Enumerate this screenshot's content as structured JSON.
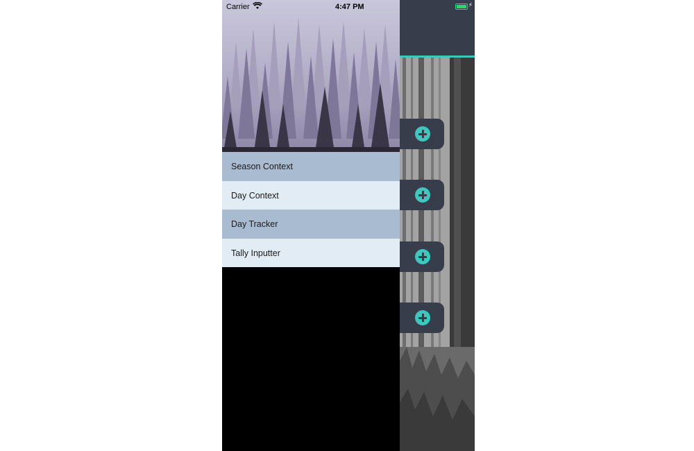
{
  "status_bar": {
    "carrier": "Carrier",
    "time": "4:47 PM",
    "battery_level": 1.0,
    "battery_color": "#2bd66b"
  },
  "drawer": {
    "menu_items": [
      {
        "label": "Season Context"
      },
      {
        "label": "Day Context"
      },
      {
        "label": "Day Tracker"
      },
      {
        "label": "Tally Inputter"
      }
    ],
    "colors": {
      "item_dark": "#a9bbd0",
      "item_light": "#e1ecf4",
      "background": "#000000"
    }
  },
  "main": {
    "navbar_color": "#383d4c",
    "accent_color": "#3ec7bd",
    "add_buttons": [
      {
        "icon": "plus-circle-icon"
      },
      {
        "icon": "plus-circle-icon"
      },
      {
        "icon": "plus-circle-icon"
      },
      {
        "icon": "plus-circle-icon"
      }
    ]
  }
}
